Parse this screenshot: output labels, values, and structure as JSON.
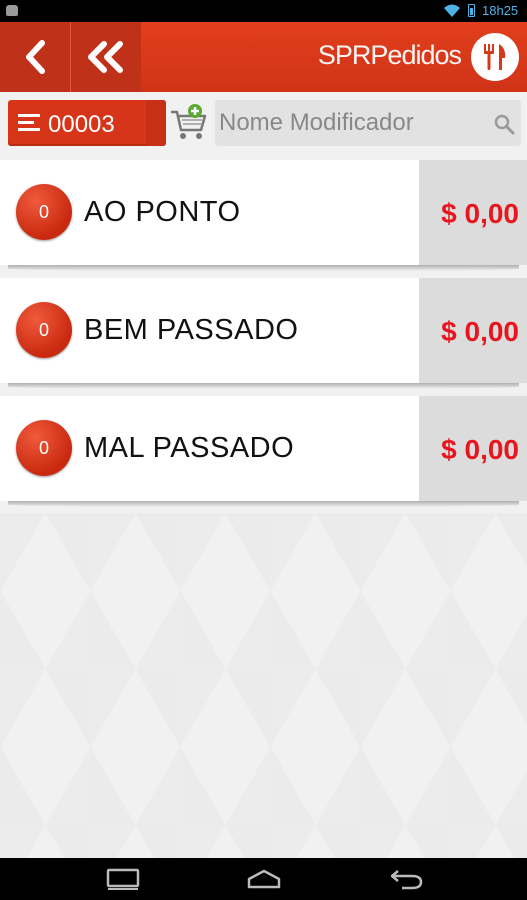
{
  "status_bar": {
    "time": "18h25"
  },
  "action_bar": {
    "back_icon": "chevron-left-icon",
    "back_all_icon": "double-chevron-left-icon",
    "brand": "SPRPedidos",
    "logo_icon": "fork-knife-icon"
  },
  "toolbar": {
    "order_number": "00003",
    "cart_icon": "cart-add-icon",
    "search_placeholder": "Nome Modificador",
    "search_icon": "search-icon"
  },
  "modifiers": [
    {
      "count": "0",
      "name": "AO PONTO",
      "price": "$ 0,00"
    },
    {
      "count": "0",
      "name": "BEM PASSADO",
      "price": "$ 0,00"
    },
    {
      "count": "0",
      "name": "MAL PASSADO",
      "price": "$ 0,00"
    }
  ],
  "colors": {
    "accent": "#d9371a",
    "price": "#e8141e",
    "status_icons": "#4fb3e8"
  }
}
